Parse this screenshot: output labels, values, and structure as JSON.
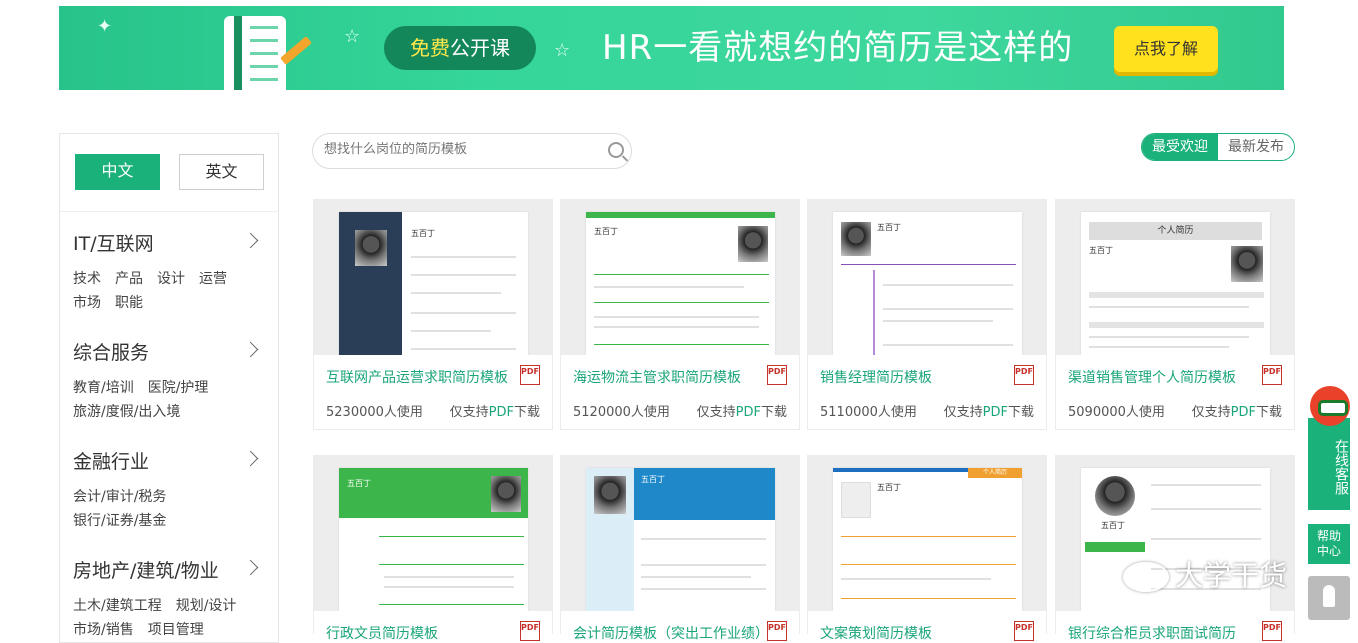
{
  "banner": {
    "badge_em": "免费",
    "badge_rest": "公开课",
    "slogan": "HR一看就想约的简历是这样的",
    "cta": "点我了解"
  },
  "lang": {
    "cn": "中文",
    "en": "英文"
  },
  "categories": [
    {
      "title": "IT/互联网",
      "tags": [
        "技术",
        "产品",
        "设计",
        "运营",
        "市场",
        "职能"
      ]
    },
    {
      "title": "综合服务",
      "tags": [
        "教育/培训",
        "医院/护理",
        "旅游/度假/出入境"
      ]
    },
    {
      "title": "金融行业",
      "tags": [
        "会计/审计/税务",
        "银行/证券/基金"
      ]
    },
    {
      "title": "房地产/建筑/物业",
      "tags": [
        "土木/建筑工程",
        "规划/设计",
        "市场/销售",
        "项目管理"
      ]
    }
  ],
  "search": {
    "placeholder": "想找什么岗位的简历模板"
  },
  "sort": {
    "popular": "最受欢迎",
    "latest": "最新发布"
  },
  "cards": [
    {
      "name": "互联网产品运营求职简历模板",
      "uses": "5230000人使用"
    },
    {
      "name": "海运物流主管求职简历模板",
      "uses": "5120000人使用"
    },
    {
      "name": "销售经理简历模板",
      "uses": "5110000人使用"
    },
    {
      "name": "渠道销售管理个人简历模板",
      "uses": "5090000人使用"
    },
    {
      "name": "行政文员简历模板",
      "uses": ""
    },
    {
      "name": "会计简历模板（突出工作业绩）",
      "uses": ""
    },
    {
      "name": "文案策划简历模板",
      "uses": ""
    },
    {
      "name": "银行综合柜员求职面试简历",
      "uses": ""
    }
  ],
  "card_common": {
    "pdf": "PDF",
    "note_pre": "仅支持",
    "note_em": "PDF",
    "note_post": "下载"
  },
  "thumb_text": {
    "name": "五百丁",
    "personal_resume": "个人简历",
    "tab_label": "个人简历"
  },
  "float": {
    "online": "在线客服",
    "help": "帮助中心"
  },
  "watermark": "大学干货",
  "colors": {
    "accent": "#1ab17a",
    "banner": "#35d69a",
    "cta": "#ffe11e",
    "pdf": "#c6312a"
  }
}
